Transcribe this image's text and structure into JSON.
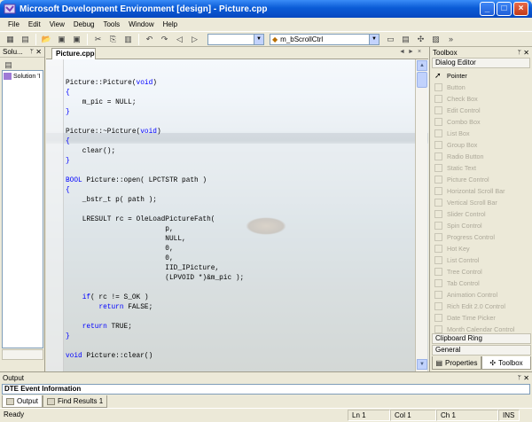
{
  "window": {
    "title": "Microsoft Development Environment [design] - Picture.cpp",
    "buttons": [
      "_",
      "□",
      "×"
    ]
  },
  "menu": [
    "File",
    "Edit",
    "View",
    "Debug",
    "Tools",
    "Window",
    "Help"
  ],
  "toolbar": {
    "config_combo": "",
    "function_combo": "m_bScrollCtrl"
  },
  "left_panel": {
    "title": "Solu...",
    "tree_items": [
      {
        "label": "Solution 'I"
      }
    ]
  },
  "editor": {
    "tab_label": "Picture.cpp",
    "tab_controls": [
      "◄",
      "►",
      "×"
    ]
  },
  "code_lines": [
    "Picture::Picture(void)",
    "{",
    "    m_pic = NULL;",
    "}",
    "",
    "Picture::~Picture(void)",
    "{",
    "    clear();",
    "}",
    "",
    "BOOL Picture::open( LPCTSTR path )",
    "{",
    "    _bstr_t p( path );",
    "",
    "    LRESULT rc = OleLoadPictureFath(",
    "                        p,",
    "                        NULL,",
    "                        0,",
    "                        0,",
    "                        IID_IPicture,",
    "                        (LPVOID *)&m_pic );",
    "",
    "    if( rc != S_OK )",
    "        return FALSE;",
    "",
    "    return TRUE;",
    "}",
    "",
    "void Picture::clear()"
  ],
  "toolbox": {
    "title": "Toolbox",
    "section": "Dialog Editor",
    "items": [
      {
        "label": "Pointer",
        "active": true
      },
      {
        "label": "Button"
      },
      {
        "label": "Check Box"
      },
      {
        "label": "Edit Control"
      },
      {
        "label": "Combo Box"
      },
      {
        "label": "List Box"
      },
      {
        "label": "Group Box"
      },
      {
        "label": "Radio Button"
      },
      {
        "label": "Static Text"
      },
      {
        "label": "Picture Control"
      },
      {
        "label": "Horizontal Scroll Bar"
      },
      {
        "label": "Vertical Scroll Bar"
      },
      {
        "label": "Slider Control"
      },
      {
        "label": "Spin Control"
      },
      {
        "label": "Progress Control"
      },
      {
        "label": "Hot Key"
      },
      {
        "label": "List Control"
      },
      {
        "label": "Tree Control"
      },
      {
        "label": "Tab Control"
      },
      {
        "label": "Animation Control"
      },
      {
        "label": "Rich Edit 2.0 Control"
      },
      {
        "label": "Date Time Picker"
      },
      {
        "label": "Month Calendar Control"
      }
    ],
    "section_clipboard": "Clipboard Ring",
    "section_general": "General",
    "tab_properties": "Properties",
    "tab_toolbox": "Toolbox"
  },
  "output": {
    "title": "Output",
    "content": "DTE Event Information",
    "tab_output": "Output",
    "tab_find": "Find Results 1"
  },
  "status": {
    "ready": "Ready",
    "line": "Ln 1",
    "col": "Col 1",
    "ch": "Ch 1",
    "ins": "INS"
  }
}
